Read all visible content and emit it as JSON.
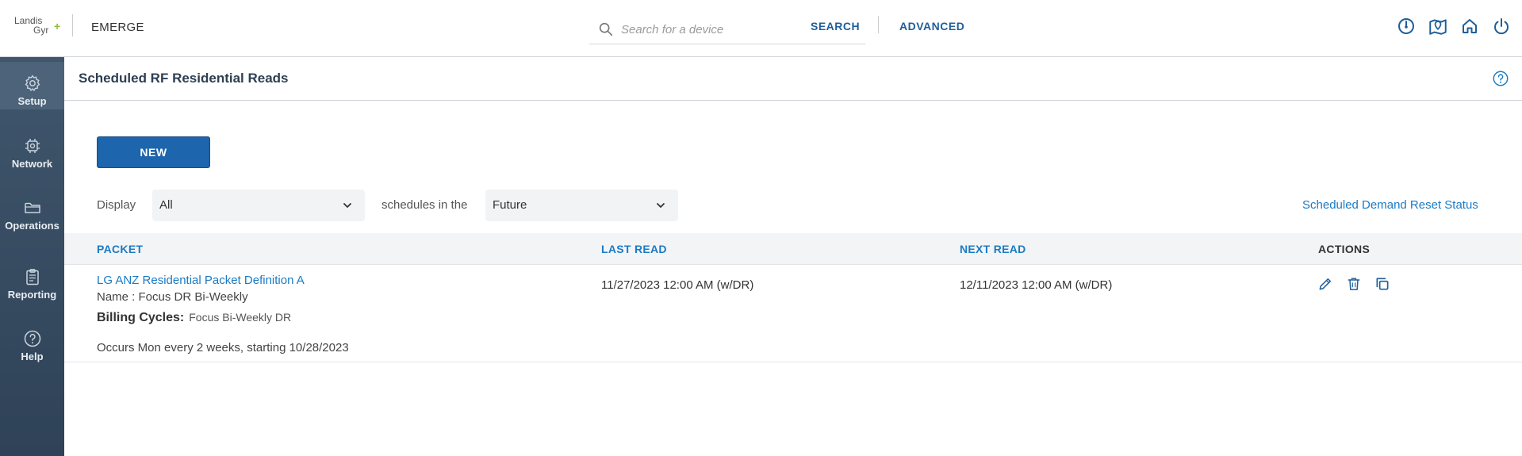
{
  "header": {
    "logo_line1": "Landis",
    "logo_line2": "Gyr",
    "logo_plus": "+",
    "app_name": "EMERGE",
    "search_placeholder": "Search for a device",
    "search_label": "SEARCH",
    "advanced_label": "ADVANCED",
    "icons": [
      "dashboard-gauge-icon",
      "map-pin-icon",
      "home-icon",
      "power-icon"
    ]
  },
  "sidebar": {
    "items": [
      {
        "label": "Setup",
        "icon": "gear-icon",
        "active": true
      },
      {
        "label": "Network",
        "icon": "network-chip-icon",
        "active": false
      },
      {
        "label": "Operations",
        "icon": "folder-icon",
        "active": false
      },
      {
        "label": "Reporting",
        "icon": "clipboard-icon",
        "active": false
      },
      {
        "label": "Help",
        "icon": "help-circle-icon",
        "active": false
      }
    ]
  },
  "page": {
    "title": "Scheduled RF Residential Reads",
    "new_label": "NEW",
    "filter": {
      "display_label": "Display",
      "display_value": "All",
      "middle_label": "schedules in the",
      "time_value": "Future"
    },
    "status_link": "Scheduled Demand Reset Status"
  },
  "table": {
    "headers": {
      "packet": "PACKET",
      "last_read": "LAST READ",
      "next_read": "NEXT READ",
      "actions": "ACTIONS"
    },
    "rows": [
      {
        "packet": "LG ANZ Residential Packet Definition A",
        "name": "Name : Focus DR Bi-Weekly",
        "billing_label": "Billing Cycles:",
        "billing_value": "Focus Bi-Weekly DR",
        "occurs": "Occurs Mon every 2 weeks, starting 10/28/2023",
        "last_read": "11/27/2023 12:00 AM (w/DR)",
        "next_read": "12/11/2023 12:00 AM (w/DR)"
      }
    ]
  },
  "colors": {
    "primary": "#1d65ad",
    "link": "#1a7bc4",
    "sidebar": "#34495e",
    "accent_green": "#8cbf3f"
  }
}
